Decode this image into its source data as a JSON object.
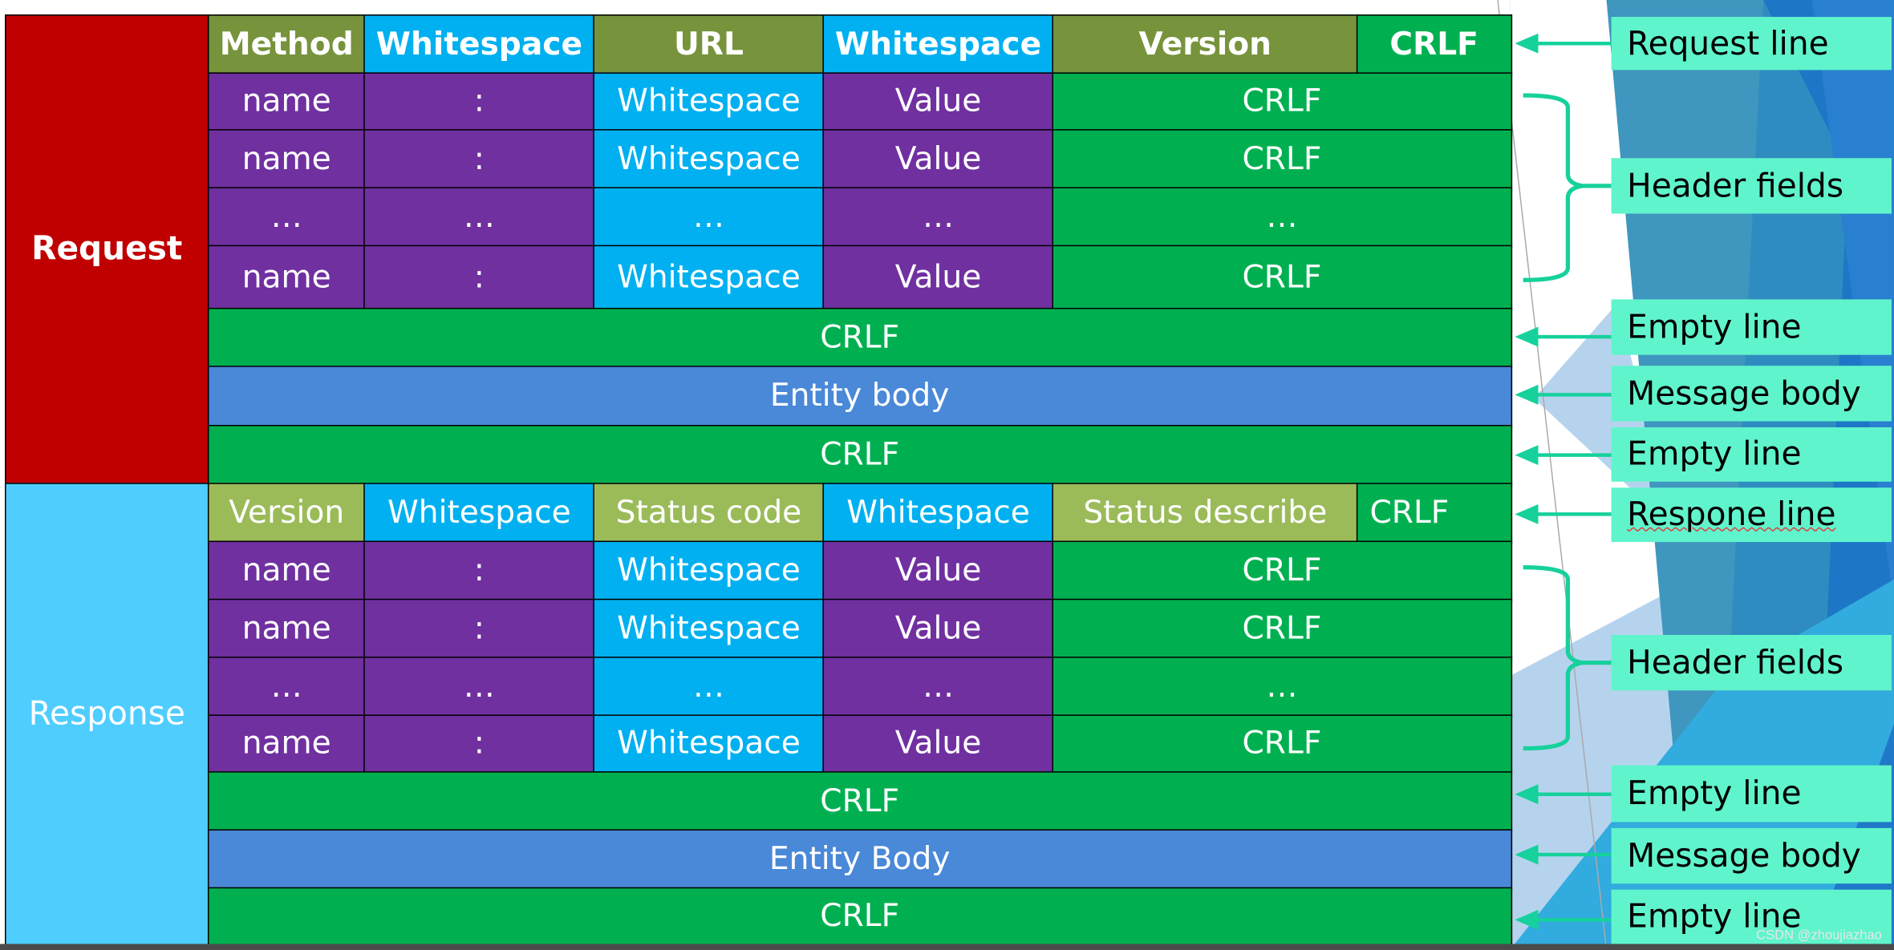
{
  "colors": {
    "olive": "#77933C",
    "lightgreen": "#9BBB59",
    "cyan": "#00B0F0",
    "purple": "#7030A0",
    "green": "#00B050",
    "blue": "#4A88D8",
    "request": "#C00000",
    "response": "#4FCDFF",
    "label_bg": "#60F4CC",
    "arrow": "#16D19C"
  },
  "request": {
    "label": "Request",
    "rows": [
      {
        "kind": "six",
        "cells": [
          "Method",
          "Whitespace",
          "URL",
          "Whitespace",
          "Version",
          "CRLF"
        ],
        "colors": [
          "olive",
          "cyan",
          "olive",
          "cyan",
          "olive",
          "green"
        ],
        "bold": true
      },
      {
        "kind": "five",
        "cells": [
          "name",
          ":",
          "Whitespace",
          "Value",
          "CRLF"
        ],
        "colors": [
          "purple",
          "purple",
          "cyan",
          "purple",
          "green"
        ]
      },
      {
        "kind": "five",
        "cells": [
          "name",
          ":",
          "Whitespace",
          "Value",
          "CRLF"
        ],
        "colors": [
          "purple",
          "purple",
          "cyan",
          "purple",
          "green"
        ]
      },
      {
        "kind": "five",
        "cells": [
          "…",
          "…",
          "…",
          "…",
          "…"
        ],
        "colors": [
          "purple",
          "purple",
          "cyan",
          "purple",
          "green"
        ]
      },
      {
        "kind": "five",
        "cells": [
          "name",
          ":",
          "Whitespace",
          "Value",
          "CRLF"
        ],
        "colors": [
          "purple",
          "purple",
          "cyan",
          "purple",
          "green"
        ]
      },
      {
        "kind": "full",
        "cells": [
          "CRLF"
        ],
        "colors": [
          "green"
        ]
      },
      {
        "kind": "full",
        "cells": [
          "Entity body"
        ],
        "colors": [
          "blue"
        ]
      },
      {
        "kind": "full",
        "cells": [
          "CRLF"
        ],
        "colors": [
          "green"
        ]
      }
    ]
  },
  "response": {
    "label": "Response",
    "rows": [
      {
        "kind": "six",
        "cells": [
          "Version",
          "Whitespace",
          "Status code",
          "Whitespace",
          "Status describe",
          "CRLF"
        ],
        "colors": [
          "lightgreen",
          "cyan",
          "lightgreen",
          "cyan",
          "lightgreen",
          "green"
        ],
        "left_last": true
      },
      {
        "kind": "five",
        "cells": [
          "name",
          ":",
          "Whitespace",
          "Value",
          "CRLF"
        ],
        "colors": [
          "purple",
          "purple",
          "cyan",
          "purple",
          "green"
        ]
      },
      {
        "kind": "five",
        "cells": [
          "name",
          ":",
          "Whitespace",
          "Value",
          "CRLF"
        ],
        "colors": [
          "purple",
          "purple",
          "cyan",
          "purple",
          "green"
        ]
      },
      {
        "kind": "five",
        "cells": [
          "…",
          "…",
          "…",
          "…",
          "…"
        ],
        "colors": [
          "purple",
          "purple",
          "cyan",
          "purple",
          "green"
        ]
      },
      {
        "kind": "five",
        "cells": [
          "name",
          ":",
          "Whitespace",
          "Value",
          "CRLF"
        ],
        "colors": [
          "purple",
          "purple",
          "cyan",
          "purple",
          "green"
        ]
      },
      {
        "kind": "full",
        "cells": [
          "CRLF"
        ],
        "colors": [
          "green"
        ]
      },
      {
        "kind": "full",
        "cells": [
          "Entity Body"
        ],
        "colors": [
          "blue"
        ]
      },
      {
        "kind": "full",
        "cells": [
          "CRLF"
        ],
        "colors": [
          "green"
        ]
      }
    ]
  },
  "annotations": [
    "Request line",
    "Header fields",
    "Empty line",
    "Message body",
    "Empty line",
    "Respone line",
    "Header fields",
    "Empty line",
    "Message body",
    "Empty line"
  ],
  "watermark": "CSDN @zhoujiazhao"
}
